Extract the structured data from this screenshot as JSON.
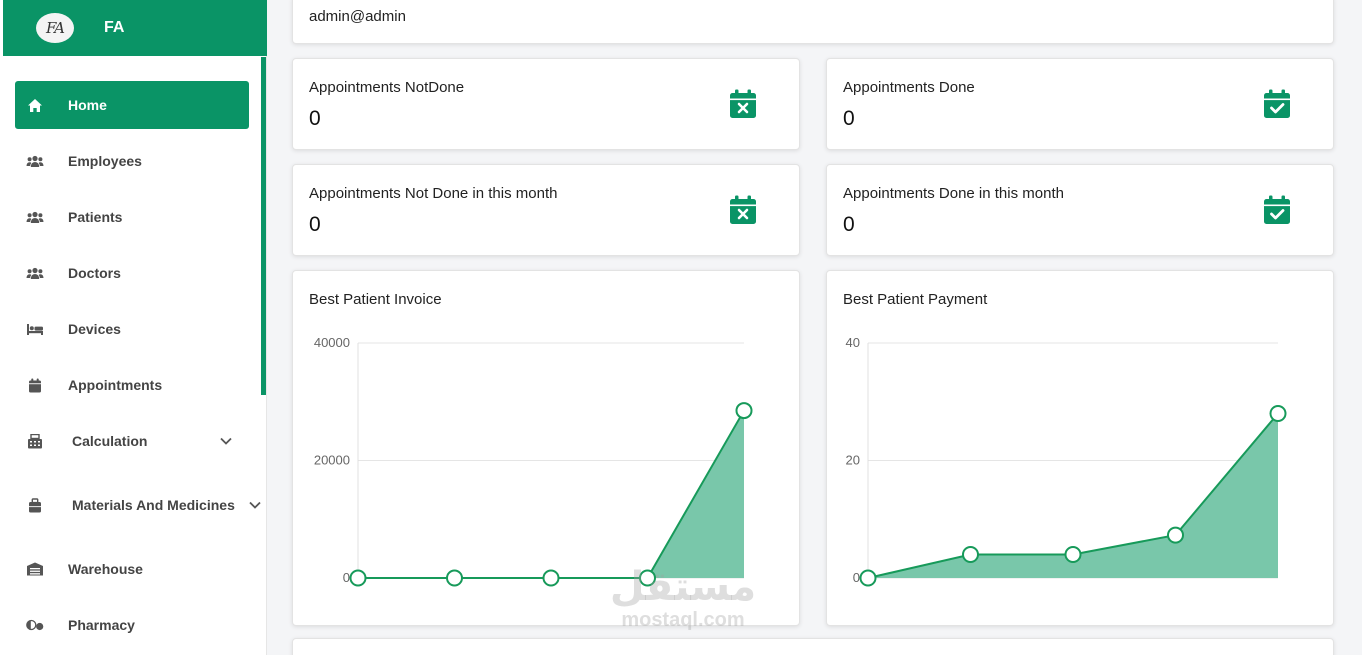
{
  "brand": {
    "logo_text": "FA",
    "name": "FA"
  },
  "sidebar": {
    "items": [
      {
        "label": "Home",
        "icon": "home-icon",
        "active": true
      },
      {
        "label": "Employees",
        "icon": "users-icon"
      },
      {
        "label": "Patients",
        "icon": "users-icon"
      },
      {
        "label": "Doctors",
        "icon": "users-icon"
      },
      {
        "label": "Devices",
        "icon": "bed-icon"
      },
      {
        "label": "Appointments",
        "icon": "calendar-icon"
      },
      {
        "label": "Calculation",
        "icon": "calculator-icon",
        "expandable": true
      },
      {
        "label": "Materials And Medicines",
        "icon": "briefcase-icon",
        "expandable": true
      },
      {
        "label": "Warehouse",
        "icon": "warehouse-icon"
      },
      {
        "label": "Pharmacy",
        "icon": "pills-icon"
      }
    ]
  },
  "header": {
    "user": "admin@admin"
  },
  "stats": [
    {
      "title": "Appointments NotDone",
      "value": "0",
      "icon": "calendar-x-icon"
    },
    {
      "title": "Appointments Done",
      "value": "0",
      "icon": "calendar-check-icon"
    },
    {
      "title": "Appointments Not Done in this month",
      "value": "0",
      "icon": "calendar-x-icon"
    },
    {
      "title": "Appointments Done in this month",
      "value": "0",
      "icon": "calendar-check-icon"
    }
  ],
  "colors": {
    "accent": "#0a9466",
    "line": "#179a5a",
    "area": "#79c7aa"
  },
  "chart_data": [
    {
      "type": "area",
      "title": "Best Patient Invoice",
      "x": [
        0,
        1,
        2,
        3,
        4
      ],
      "values": [
        0,
        0,
        0,
        0,
        28500
      ],
      "ylim": [
        0,
        40000
      ],
      "yticks": [
        "0",
        "20000",
        "40000"
      ],
      "grid": true,
      "legend": "none"
    },
    {
      "type": "area",
      "title": "Best Patient Payment",
      "x": [
        0,
        1,
        2,
        3,
        4
      ],
      "values": [
        0,
        4,
        4,
        7.3,
        28
      ],
      "ylim": [
        0,
        40
      ],
      "yticks": [
        "0",
        "20",
        "40"
      ],
      "grid": true,
      "legend": "none"
    }
  ],
  "watermark": {
    "arabic": "مستقل",
    "latin": "mostaql.com"
  }
}
